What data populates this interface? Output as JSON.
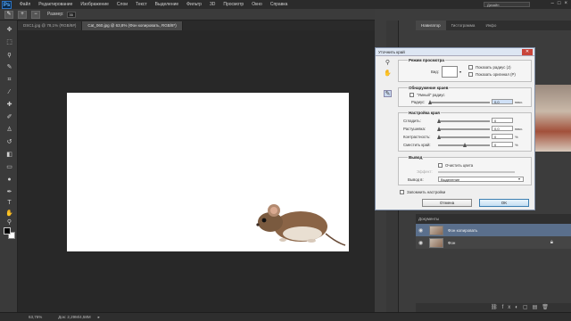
{
  "menu": {
    "logo": "Ps",
    "items": [
      "Файл",
      "Редактирование",
      "Изображение",
      "Слои",
      "Текст",
      "Выделение",
      "Фильтр",
      "3D",
      "Просмотр",
      "Окно",
      "Справка"
    ],
    "workspace": "Дизайн"
  },
  "options": {
    "size_label": "Размер:",
    "size_value": "35"
  },
  "tabs": [
    {
      "label": "DSC1.jpg @ 78,1% (RGB/8#)"
    },
    {
      "label": "Cat_060.jpg @ 63,8% (Фон копировать, RGB/8*)"
    }
  ],
  "status": {
    "zoom": "63,76%",
    "doc": "Док: 2,29M/4,58M"
  },
  "panels": {
    "nav_tabs": [
      "Навигатор",
      "Гистограмма",
      "Инфо"
    ],
    "layers_title": "Документы",
    "layers": [
      {
        "name": "Фон копировать"
      },
      {
        "name": "Фон"
      }
    ]
  },
  "dialog": {
    "title": "Уточнить край",
    "view_mode": {
      "title": "Режим просмотра",
      "view_label": "Вид:",
      "show_radius": "Показать радиус (J)",
      "show_original": "Показать оригинал (P)"
    },
    "edge": {
      "title": "Обнаружение краев",
      "smart_radius": "\"Умный\" радиус",
      "radius_label": "Радиус:",
      "radius_value": "0,0",
      "radius_unit": "пикс."
    },
    "adjust": {
      "title": "Настройка края",
      "rows": [
        {
          "label": "Сгладить:",
          "value": "0",
          "unit": ""
        },
        {
          "label": "Растушевка:",
          "value": "0,0",
          "unit": "пикс."
        },
        {
          "label": "Контрастность:",
          "value": "0",
          "unit": "%"
        },
        {
          "label": "Сместить край:",
          "value": "0",
          "unit": "%"
        }
      ]
    },
    "output": {
      "title": "Вывод",
      "clear_colors": "Очистить цвета",
      "amount_label": "Эффект:",
      "output_to_label": "Вывод в:",
      "output_to_value": "Выделение"
    },
    "remember": "Запомнить настройки",
    "cancel": "Отмена",
    "ok": "OK"
  }
}
